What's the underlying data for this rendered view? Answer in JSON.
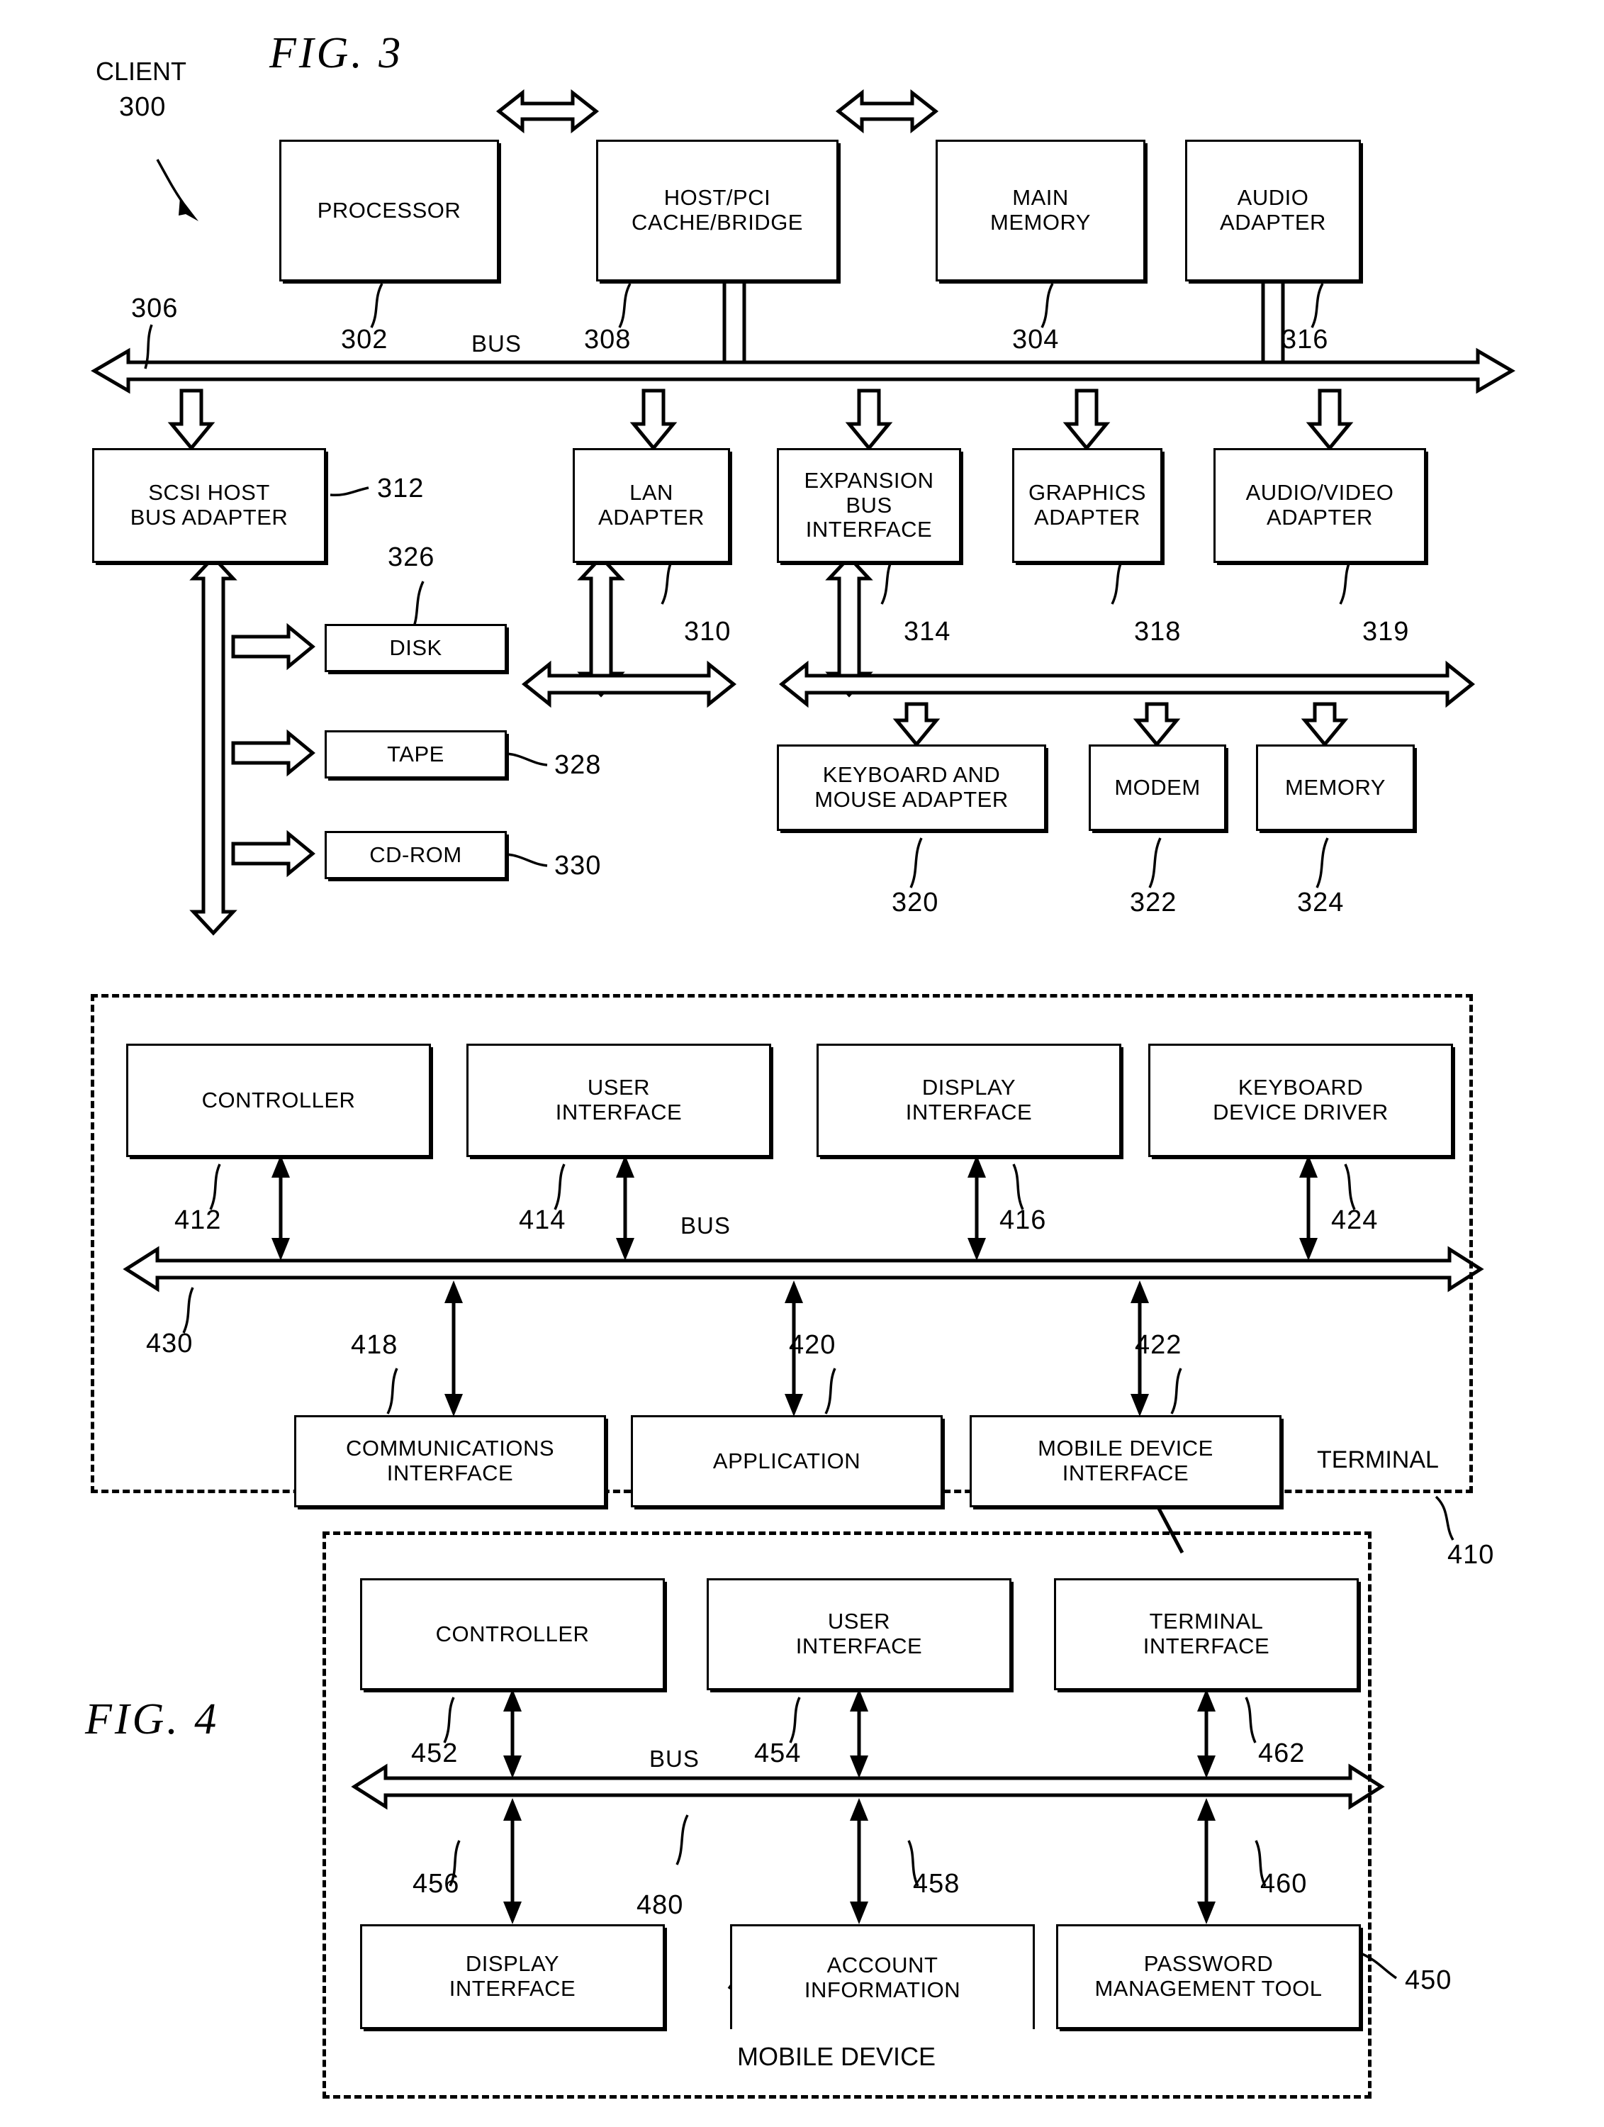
{
  "figures": [
    {
      "id": "fig3",
      "title": "FIG.  3"
    },
    {
      "id": "fig4",
      "title": "FIG.  4"
    }
  ],
  "fig3": {
    "title": "FIG.  3",
    "client_label": "CLIENT",
    "client_ref": "300",
    "bus_label": "BUS",
    "row1": [
      {
        "ref": "302",
        "lines": [
          "PROCESSOR"
        ]
      },
      {
        "ref": "308",
        "lines": [
          "HOST/PCI",
          "CACHE/BRIDGE"
        ]
      },
      {
        "ref": "304",
        "lines": [
          "MAIN",
          "MEMORY"
        ]
      },
      {
        "ref": "316",
        "lines": [
          "AUDIO",
          "ADAPTER"
        ]
      }
    ],
    "bus_ref": "306",
    "row2": [
      {
        "ref": "312",
        "lines": [
          "SCSI HOST",
          "BUS ADAPTER"
        ]
      },
      {
        "ref": "310",
        "lines": [
          "LAN",
          "ADAPTER"
        ]
      },
      {
        "ref": "314",
        "lines": [
          "EXPANSION",
          "BUS",
          "INTERFACE"
        ]
      },
      {
        "ref": "318",
        "lines": [
          "GRAPHICS",
          "ADAPTER"
        ]
      },
      {
        "ref": "319",
        "lines": [
          "AUDIO/VIDEO",
          "ADAPTER"
        ]
      }
    ],
    "scsi_devices": [
      {
        "ref": "326",
        "lines": [
          "DISK"
        ]
      },
      {
        "ref": "328",
        "lines": [
          "TAPE"
        ]
      },
      {
        "ref": "330",
        "lines": [
          "CD-ROM"
        ]
      }
    ],
    "expansion_devices": [
      {
        "ref": "320",
        "lines": [
          "KEYBOARD AND",
          "MOUSE ADAPTER"
        ]
      },
      {
        "ref": "322",
        "lines": [
          "MODEM"
        ]
      },
      {
        "ref": "324",
        "lines": [
          "MEMORY"
        ]
      }
    ]
  },
  "fig4": {
    "title": "FIG.  4",
    "terminal": {
      "name": "TERMINAL",
      "ref": "410",
      "bus_label": "BUS",
      "bus_ref": "430",
      "top_modules": [
        {
          "ref": "412",
          "lines": [
            "CONTROLLER"
          ]
        },
        {
          "ref": "414",
          "lines": [
            "USER",
            "INTERFACE"
          ]
        },
        {
          "ref": "416",
          "lines": [
            "DISPLAY",
            "INTERFACE"
          ]
        },
        {
          "ref": "424",
          "lines": [
            "KEYBOARD",
            "DEVICE DRIVER"
          ]
        }
      ],
      "bottom_modules": [
        {
          "ref": "418",
          "lines": [
            "COMMUNICATIONS",
            "INTERFACE"
          ]
        },
        {
          "ref": "420",
          "lines": [
            "APPLICATION"
          ]
        },
        {
          "ref": "422",
          "lines": [
            "MOBILE DEVICE",
            "INTERFACE"
          ]
        }
      ]
    },
    "mobile_device": {
      "name": "MOBILE DEVICE",
      "ref": "450",
      "bus_label": "BUS",
      "bus_ref": "480",
      "top_modules": [
        {
          "ref": "452",
          "lines": [
            "CONTROLLER"
          ]
        },
        {
          "ref": "454",
          "lines": [
            "USER",
            "INTERFACE"
          ]
        },
        {
          "ref": "462",
          "lines": [
            "TERMINAL",
            "INTERFACE"
          ]
        }
      ],
      "bottom_modules": [
        {
          "ref": "456",
          "lines": [
            "DISPLAY",
            "INTERFACE"
          ]
        },
        {
          "ref": "458",
          "lines": [
            "ACCOUNT",
            "INFORMATION"
          ]
        },
        {
          "ref": "460",
          "lines": [
            "PASSWORD",
            "MANAGEMENT TOOL"
          ]
        }
      ]
    }
  },
  "colors": {
    "ink": "#000000",
    "paper": "#ffffff"
  }
}
